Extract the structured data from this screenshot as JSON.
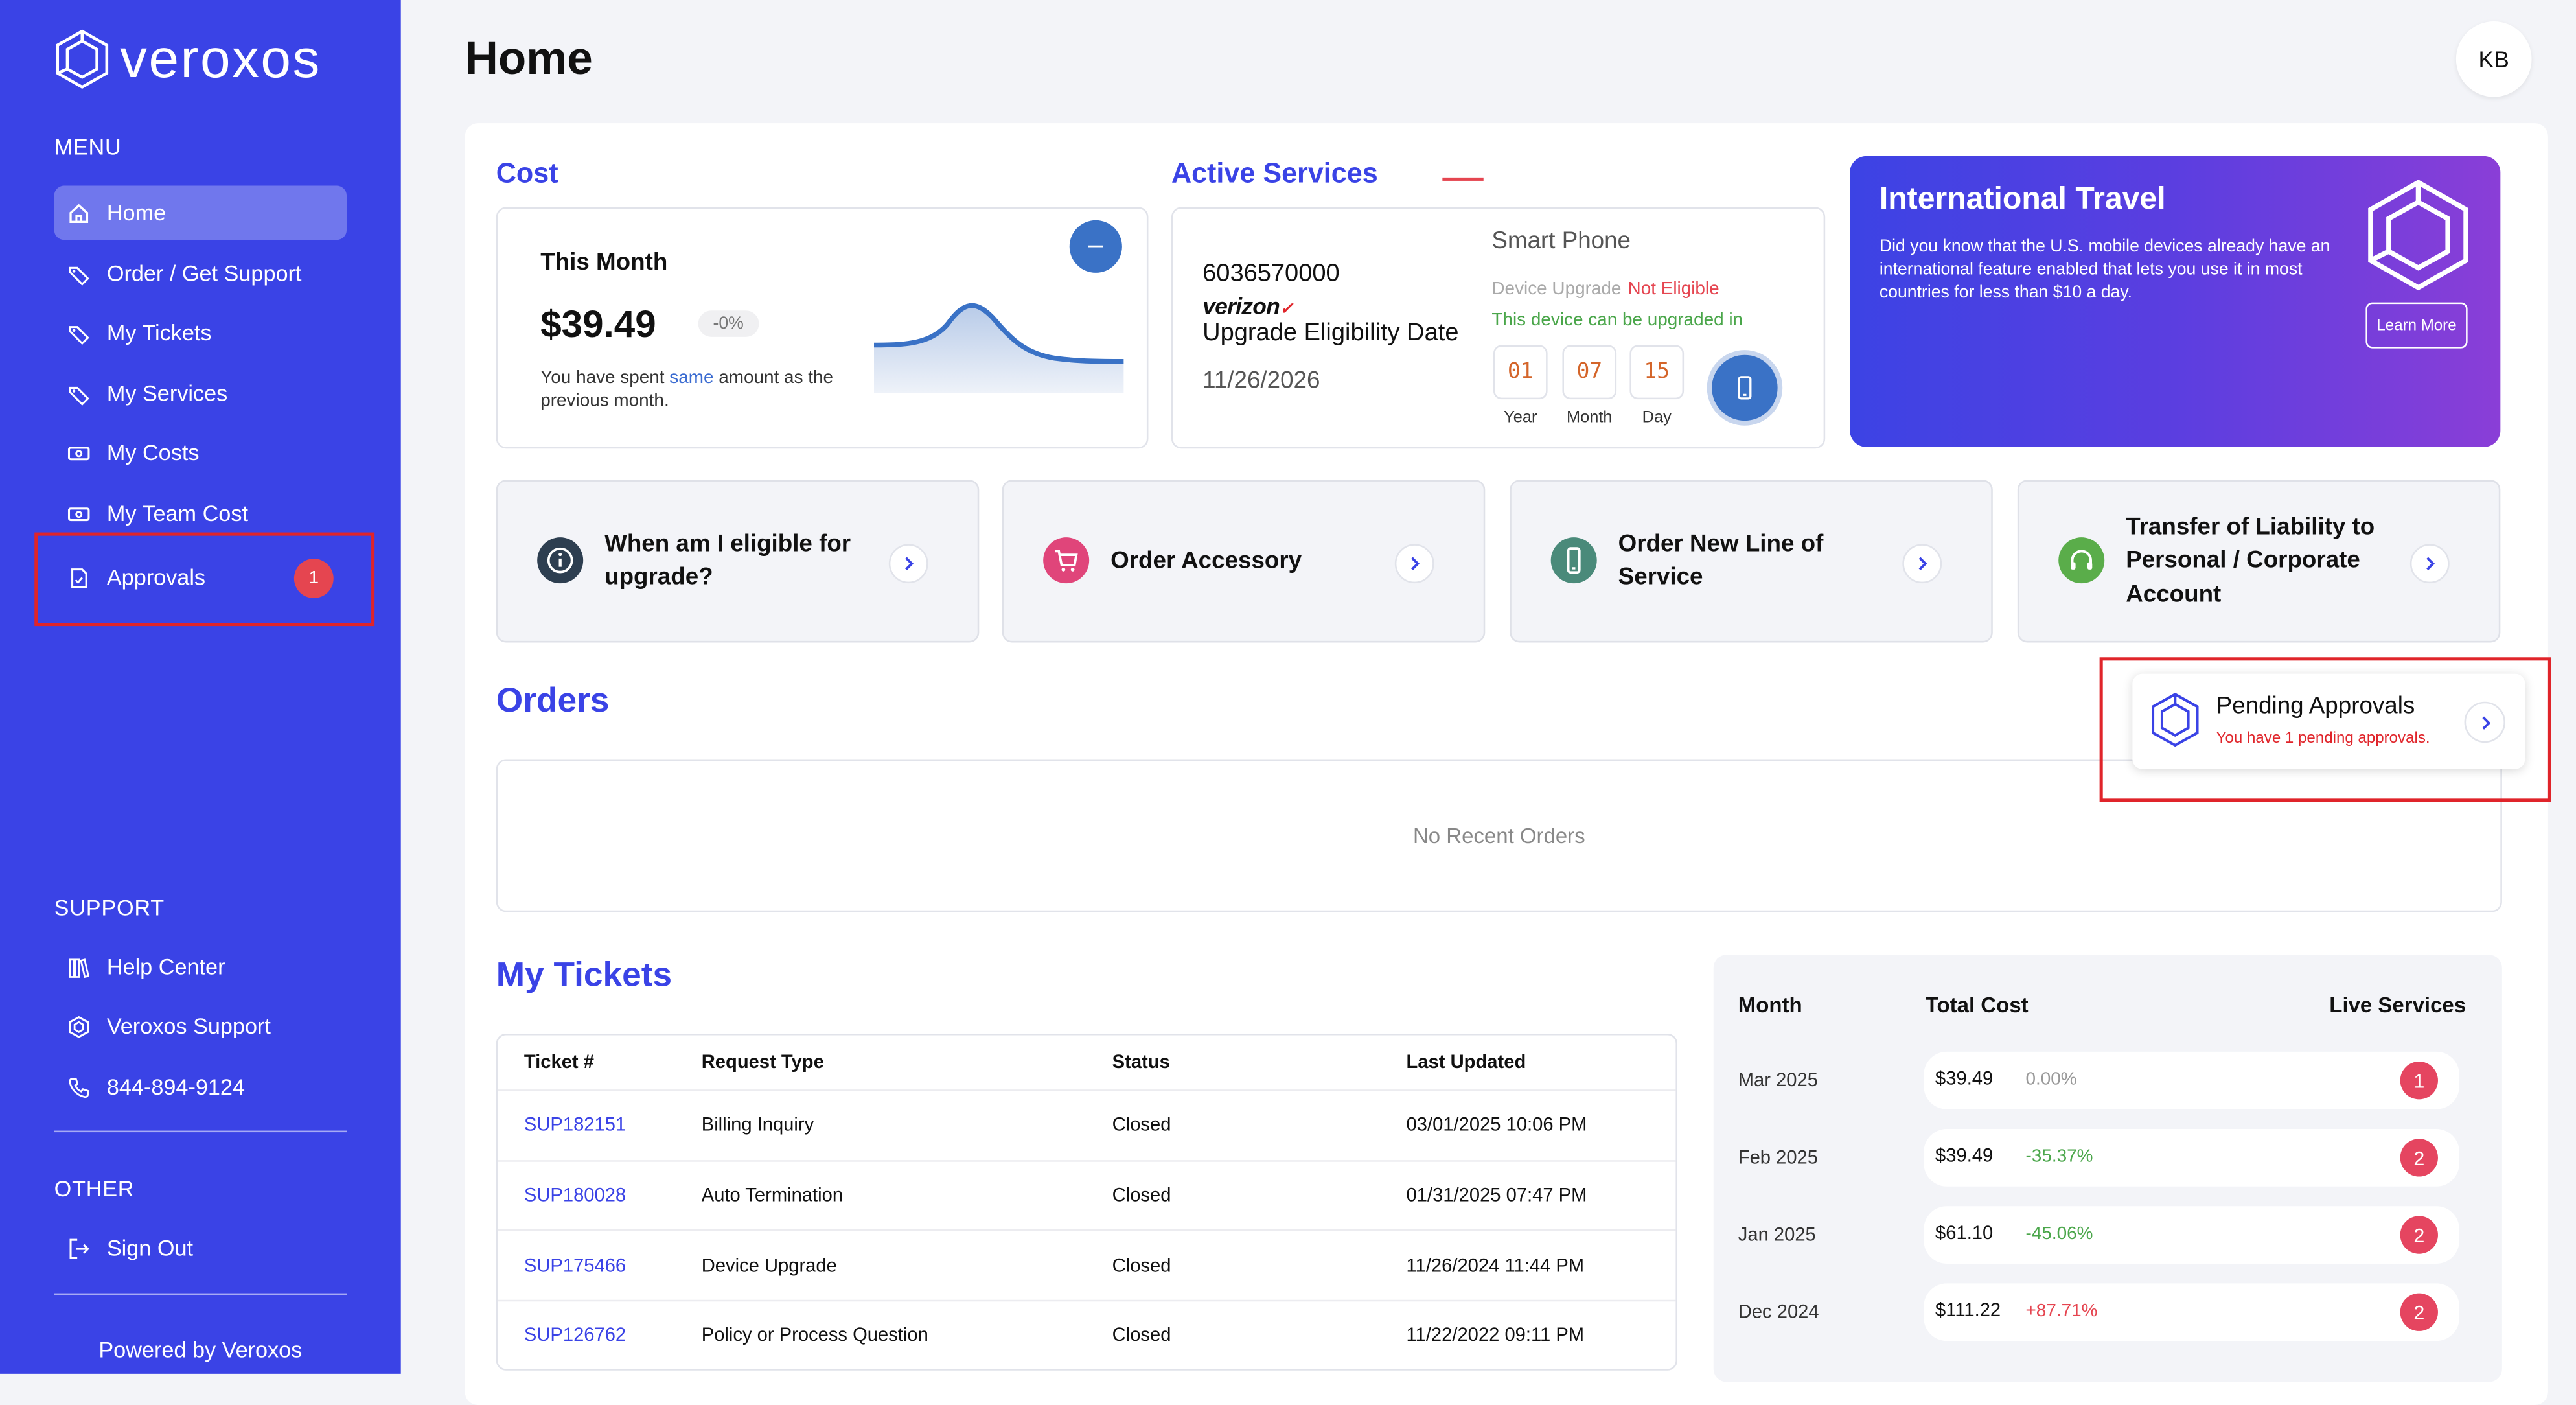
{
  "brand": {
    "name": "veroxos",
    "powered_by": "Powered by Veroxos"
  },
  "sidebar": {
    "menu_title": "MENU",
    "items": [
      {
        "label": "Home",
        "icon": "home-icon"
      },
      {
        "label": "Order / Get Support",
        "icon": "tag-icon"
      },
      {
        "label": "My Tickets",
        "icon": "tag-icon"
      },
      {
        "label": "My Services",
        "icon": "tag-icon"
      },
      {
        "label": "My Costs",
        "icon": "cash-icon"
      },
      {
        "label": "My Team Cost",
        "icon": "cash-icon"
      },
      {
        "label": "Approvals",
        "icon": "document-icon",
        "badge": "1"
      }
    ],
    "support_title": "SUPPORT",
    "support_items": [
      {
        "label": "Help Center",
        "icon": "books-icon"
      },
      {
        "label": "Veroxos Support",
        "icon": "hexagon-icon"
      },
      {
        "label": "844-894-9124",
        "icon": "phone-icon"
      }
    ],
    "other_title": "OTHER",
    "other_items": [
      {
        "label": "Sign Out",
        "icon": "sign-out-icon"
      }
    ]
  },
  "header": {
    "title": "Home",
    "avatar": "KB"
  },
  "cost": {
    "heading": "Cost",
    "this_month_label": "This Month",
    "amount": "$39.49",
    "change": "-0%",
    "note_prefix": "You have spent ",
    "note_highlight": "same",
    "note_suffix": " amount as the previous month.",
    "toggle": "–"
  },
  "active_services": {
    "heading": "Active Services",
    "number": "6036570000",
    "carrier": "verizon",
    "carrier_mark": "✓",
    "upgrade_label": "Upgrade Eligibility Date",
    "upgrade_date": "11/26/2026",
    "device_type": "Smart Phone",
    "device_upgrade_label": "Device Upgrade",
    "device_upgrade_status": "Not Eligible",
    "can_upgrade_text": "This device can be upgraded in",
    "countdown": [
      {
        "value": "01",
        "label": "Year"
      },
      {
        "value": "07",
        "label": "Month"
      },
      {
        "value": "15",
        "label": "Day"
      }
    ]
  },
  "travel": {
    "title": "International Travel",
    "body": "Did you know that the U.S. mobile devices already have an international feature enabled that lets you use it in most countries for less than $10 a day.",
    "button": "Learn More"
  },
  "actions": [
    {
      "label": "When am I eligible for upgrade?",
      "icon": "info-icon",
      "color": "#2d3e50"
    },
    {
      "label": "Order Accessory",
      "icon": "cart-icon",
      "color": "#e0457a"
    },
    {
      "label": "Order New Line of Service",
      "icon": "mobile-icon",
      "color": "#4a8a7a"
    },
    {
      "label": "Transfer of Liability to Personal / Corporate Account",
      "icon": "headset-icon",
      "color": "#5aad4a"
    }
  ],
  "orders": {
    "heading": "Orders",
    "empty": "No Recent Orders"
  },
  "pending": {
    "title": "Pending Approvals",
    "subtitle": "You have 1 pending approvals."
  },
  "tickets": {
    "heading": "My Tickets",
    "columns": [
      "Ticket #",
      "Request Type",
      "Status",
      "Last Updated"
    ],
    "rows": [
      [
        "SUP182151",
        "Billing Inquiry",
        "Closed",
        "03/01/2025 10:06 PM"
      ],
      [
        "SUP180028",
        "Auto Termination",
        "Closed",
        "01/31/2025 07:47 PM"
      ],
      [
        "SUP175466",
        "Device Upgrade",
        "Closed",
        "11/26/2024 11:44 PM"
      ],
      [
        "SUP126762",
        "Policy or Process Question",
        "Closed",
        "11/22/2022 09:11 PM"
      ]
    ]
  },
  "costs_table": {
    "columns": [
      "Month",
      "Total Cost",
      "Live Services"
    ],
    "rows": [
      {
        "month": "Mar 2025",
        "cost": "$39.49",
        "change": "0.00%",
        "change_color": "#999999",
        "services": "1"
      },
      {
        "month": "Feb 2025",
        "cost": "$39.49",
        "change": "-35.37%",
        "change_color": "#4aa64a",
        "services": "2"
      },
      {
        "month": "Jan 2025",
        "cost": "$61.10",
        "change": "-45.06%",
        "change_color": "#4aa64a",
        "services": "2"
      },
      {
        "month": "Dec 2024",
        "cost": "$111.22",
        "change": "+87.71%",
        "change_color": "#e54550",
        "services": "2"
      }
    ]
  },
  "colors": {
    "accent": "#3a43e6",
    "sidebar": "#3a43e6",
    "alert": "#e54550"
  }
}
